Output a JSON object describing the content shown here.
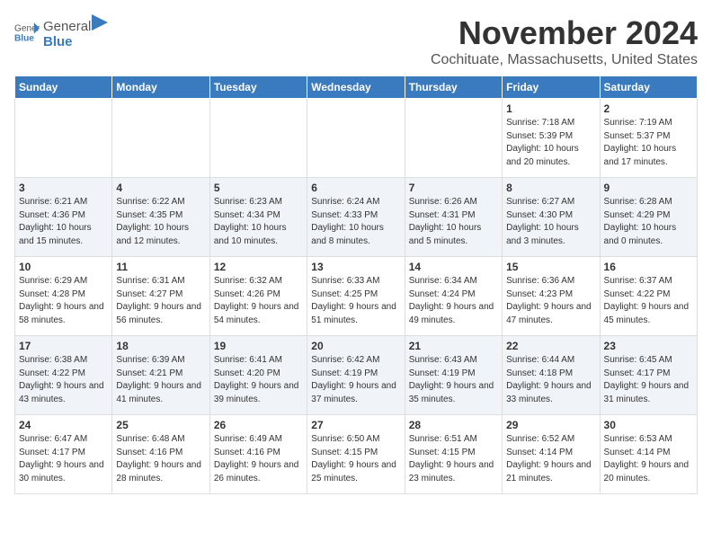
{
  "header": {
    "logo_general": "General",
    "logo_blue": "Blue",
    "month": "November 2024",
    "location": "Cochituate, Massachusetts, United States"
  },
  "weekdays": [
    "Sunday",
    "Monday",
    "Tuesday",
    "Wednesday",
    "Thursday",
    "Friday",
    "Saturday"
  ],
  "weeks": [
    [
      {
        "day": "",
        "info": ""
      },
      {
        "day": "",
        "info": ""
      },
      {
        "day": "",
        "info": ""
      },
      {
        "day": "",
        "info": ""
      },
      {
        "day": "",
        "info": ""
      },
      {
        "day": "1",
        "info": "Sunrise: 7:18 AM\nSunset: 5:39 PM\nDaylight: 10 hours and 20 minutes."
      },
      {
        "day": "2",
        "info": "Sunrise: 7:19 AM\nSunset: 5:37 PM\nDaylight: 10 hours and 17 minutes."
      }
    ],
    [
      {
        "day": "3",
        "info": "Sunrise: 6:21 AM\nSunset: 4:36 PM\nDaylight: 10 hours and 15 minutes."
      },
      {
        "day": "4",
        "info": "Sunrise: 6:22 AM\nSunset: 4:35 PM\nDaylight: 10 hours and 12 minutes."
      },
      {
        "day": "5",
        "info": "Sunrise: 6:23 AM\nSunset: 4:34 PM\nDaylight: 10 hours and 10 minutes."
      },
      {
        "day": "6",
        "info": "Sunrise: 6:24 AM\nSunset: 4:33 PM\nDaylight: 10 hours and 8 minutes."
      },
      {
        "day": "7",
        "info": "Sunrise: 6:26 AM\nSunset: 4:31 PM\nDaylight: 10 hours and 5 minutes."
      },
      {
        "day": "8",
        "info": "Sunrise: 6:27 AM\nSunset: 4:30 PM\nDaylight: 10 hours and 3 minutes."
      },
      {
        "day": "9",
        "info": "Sunrise: 6:28 AM\nSunset: 4:29 PM\nDaylight: 10 hours and 0 minutes."
      }
    ],
    [
      {
        "day": "10",
        "info": "Sunrise: 6:29 AM\nSunset: 4:28 PM\nDaylight: 9 hours and 58 minutes."
      },
      {
        "day": "11",
        "info": "Sunrise: 6:31 AM\nSunset: 4:27 PM\nDaylight: 9 hours and 56 minutes."
      },
      {
        "day": "12",
        "info": "Sunrise: 6:32 AM\nSunset: 4:26 PM\nDaylight: 9 hours and 54 minutes."
      },
      {
        "day": "13",
        "info": "Sunrise: 6:33 AM\nSunset: 4:25 PM\nDaylight: 9 hours and 51 minutes."
      },
      {
        "day": "14",
        "info": "Sunrise: 6:34 AM\nSunset: 4:24 PM\nDaylight: 9 hours and 49 minutes."
      },
      {
        "day": "15",
        "info": "Sunrise: 6:36 AM\nSunset: 4:23 PM\nDaylight: 9 hours and 47 minutes."
      },
      {
        "day": "16",
        "info": "Sunrise: 6:37 AM\nSunset: 4:22 PM\nDaylight: 9 hours and 45 minutes."
      }
    ],
    [
      {
        "day": "17",
        "info": "Sunrise: 6:38 AM\nSunset: 4:22 PM\nDaylight: 9 hours and 43 minutes."
      },
      {
        "day": "18",
        "info": "Sunrise: 6:39 AM\nSunset: 4:21 PM\nDaylight: 9 hours and 41 minutes."
      },
      {
        "day": "19",
        "info": "Sunrise: 6:41 AM\nSunset: 4:20 PM\nDaylight: 9 hours and 39 minutes."
      },
      {
        "day": "20",
        "info": "Sunrise: 6:42 AM\nSunset: 4:19 PM\nDaylight: 9 hours and 37 minutes."
      },
      {
        "day": "21",
        "info": "Sunrise: 6:43 AM\nSunset: 4:19 PM\nDaylight: 9 hours and 35 minutes."
      },
      {
        "day": "22",
        "info": "Sunrise: 6:44 AM\nSunset: 4:18 PM\nDaylight: 9 hours and 33 minutes."
      },
      {
        "day": "23",
        "info": "Sunrise: 6:45 AM\nSunset: 4:17 PM\nDaylight: 9 hours and 31 minutes."
      }
    ],
    [
      {
        "day": "24",
        "info": "Sunrise: 6:47 AM\nSunset: 4:17 PM\nDaylight: 9 hours and 30 minutes."
      },
      {
        "day": "25",
        "info": "Sunrise: 6:48 AM\nSunset: 4:16 PM\nDaylight: 9 hours and 28 minutes."
      },
      {
        "day": "26",
        "info": "Sunrise: 6:49 AM\nSunset: 4:16 PM\nDaylight: 9 hours and 26 minutes."
      },
      {
        "day": "27",
        "info": "Sunrise: 6:50 AM\nSunset: 4:15 PM\nDaylight: 9 hours and 25 minutes."
      },
      {
        "day": "28",
        "info": "Sunrise: 6:51 AM\nSunset: 4:15 PM\nDaylight: 9 hours and 23 minutes."
      },
      {
        "day": "29",
        "info": "Sunrise: 6:52 AM\nSunset: 4:14 PM\nDaylight: 9 hours and 21 minutes."
      },
      {
        "day": "30",
        "info": "Sunrise: 6:53 AM\nSunset: 4:14 PM\nDaylight: 9 hours and 20 minutes."
      }
    ]
  ]
}
